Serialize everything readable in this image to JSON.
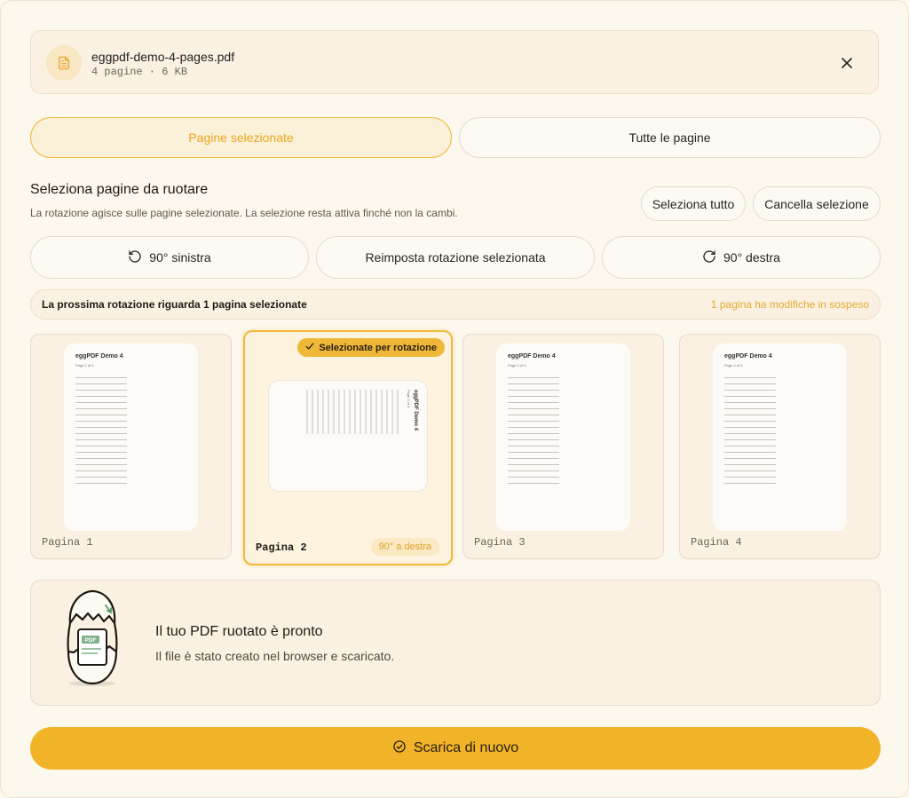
{
  "file": {
    "name": "eggpdf-demo-4-pages.pdf",
    "meta": "4 pagine · 6 KB",
    "icon": "document-icon",
    "close_icon": "close-icon"
  },
  "mode_tabs": [
    {
      "label": "Pagine selezionate",
      "active": true
    },
    {
      "label": "Tutte le pagine",
      "active": false
    }
  ],
  "selection": {
    "title": "Seleziona pagine da ruotare",
    "subtitle": "La rotazione agisce sulle pagine selezionate. La selezione resta attiva finché non la cambi.",
    "select_all": "Seleziona tutto",
    "clear_selection": "Cancella selezione"
  },
  "rotation_buttons": {
    "left": "90° sinistra",
    "reset": "Reimposta rotazione selezionata",
    "right": "90° destra"
  },
  "status": {
    "left": "La prossima rotazione riguarda 1 pagina selezionate",
    "right": "1 pagina ha modifiche in sospeso"
  },
  "pages": [
    {
      "label": "Pagina 1",
      "doc_title": "eggPDF Demo 4",
      "doc_sub": "Page 1 of 4"
    },
    {
      "label": "Pagina 2",
      "doc_title": "eggPDF Demo 4",
      "doc_sub": "Page 2 of 4",
      "badge": "Selezionate per rotazione",
      "rotation": "90° a destra"
    },
    {
      "label": "Pagina 3",
      "doc_title": "eggPDF Demo 4",
      "doc_sub": "Page 3 of 4"
    },
    {
      "label": "Pagina 4",
      "doc_title": "eggPDF Demo 4",
      "doc_sub": "Page 4 of 4"
    }
  ],
  "ready": {
    "title": "Il tuo PDF ruotato è pronto",
    "subtitle": "Il file è stato creato nel browser e scaricato.",
    "pdf_tag": "PDF"
  },
  "download": {
    "label": "Scarica di nuovo"
  },
  "colors": {
    "accent": "#f1b327",
    "accent_text": "#eaa71f",
    "background": "#fdf8ee"
  }
}
